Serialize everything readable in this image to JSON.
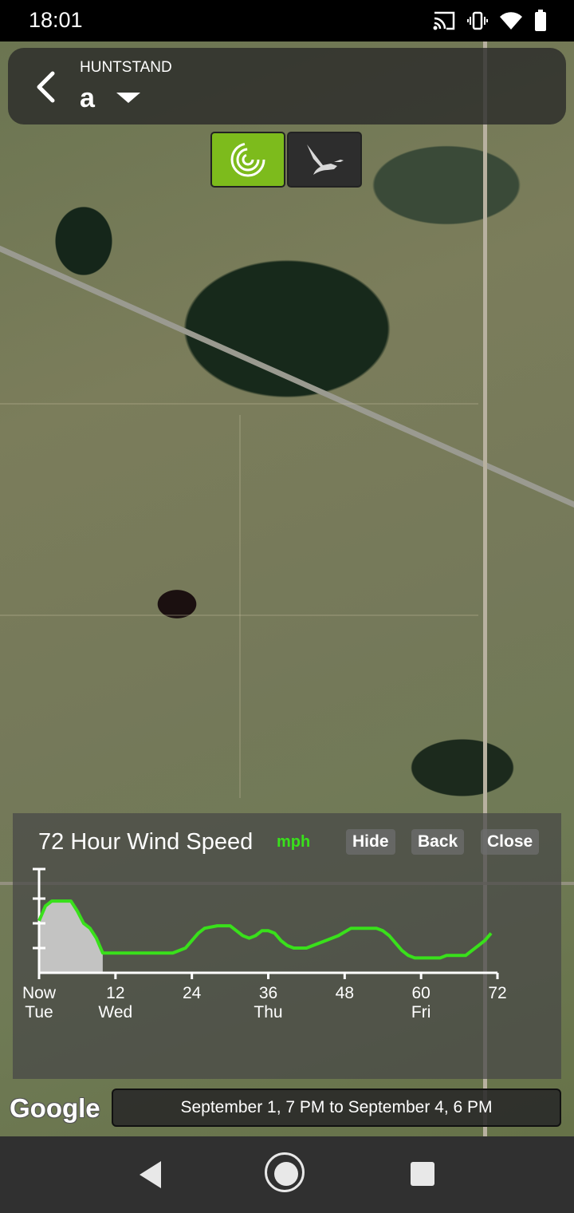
{
  "status_bar": {
    "time": "18:01",
    "icons": [
      "cast-icon",
      "vibrate-icon",
      "wifi-icon",
      "battery-icon"
    ]
  },
  "header": {
    "app_name": "HUNTSTAND",
    "map_name": "a",
    "back_icon": "chevron-left-icon",
    "dropdown_icon": "caret-down-icon"
  },
  "mode_toggle": {
    "buttons": [
      {
        "icon": "wind-target-icon",
        "active": true
      },
      {
        "icon": "goose-icon",
        "active": false
      }
    ],
    "active_color": "#7dbb1c"
  },
  "wind_panel": {
    "title": "72 Hour Wind Speed",
    "unit": "mph",
    "hide_label": "Hide",
    "back_label": "Back",
    "close_label": "Close"
  },
  "chart_data": {
    "type": "area",
    "title": "72 Hour Wind Speed",
    "ylabel": "",
    "unit": "mph",
    "x_tick_labels": [
      "Now",
      "12",
      "24",
      "36",
      "48",
      "60",
      "72"
    ],
    "x_tick_values": [
      0,
      12,
      24,
      36,
      48,
      60,
      72
    ],
    "day_labels": [
      {
        "x": 0,
        "label": "Tue"
      },
      {
        "x": 12,
        "label": "Wed"
      },
      {
        "x": 36,
        "label": "Thu"
      },
      {
        "x": 60,
        "label": "Fri"
      }
    ],
    "xlim": [
      0,
      72
    ],
    "ylim": [
      0,
      4
    ],
    "series_color": "#39e01b",
    "history_fill": "#cfcfcf",
    "series": [
      {
        "x": [
          0,
          1,
          2,
          4,
          5,
          6,
          7,
          8,
          9,
          10,
          12,
          14,
          18,
          21,
          23,
          24,
          25,
          26,
          28,
          30,
          31,
          32,
          33,
          34,
          35,
          36,
          37,
          38,
          39,
          40,
          41,
          42,
          43,
          45,
          47,
          49,
          51,
          52,
          53,
          54,
          55,
          56,
          57,
          58,
          59,
          60,
          61,
          62,
          63,
          64,
          65,
          66,
          67,
          68,
          69,
          70,
          71
        ],
        "y": [
          2.1,
          2.7,
          2.9,
          2.9,
          2.9,
          2.5,
          2.0,
          1.8,
          1.4,
          0.8,
          0.8,
          0.8,
          0.8,
          0.8,
          1.0,
          1.3,
          1.6,
          1.8,
          1.9,
          1.9,
          1.7,
          1.5,
          1.4,
          1.5,
          1.7,
          1.7,
          1.6,
          1.3,
          1.1,
          1.0,
          1.0,
          1.0,
          1.1,
          1.3,
          1.5,
          1.8,
          1.8,
          1.8,
          1.8,
          1.7,
          1.5,
          1.2,
          0.9,
          0.7,
          0.6,
          0.6,
          0.6,
          0.6,
          0.6,
          0.7,
          0.7,
          0.7,
          0.7,
          0.9,
          1.1,
          1.3,
          1.6
        ]
      }
    ],
    "history_x_end": 10,
    "grid": false
  },
  "footer": {
    "google_label": "Google",
    "date_range": "September 1, 7 PM to September 4, 6 PM"
  },
  "nav_bar": {
    "icons": [
      "back-triangle-icon",
      "home-circle-icon",
      "recents-square-icon"
    ]
  }
}
